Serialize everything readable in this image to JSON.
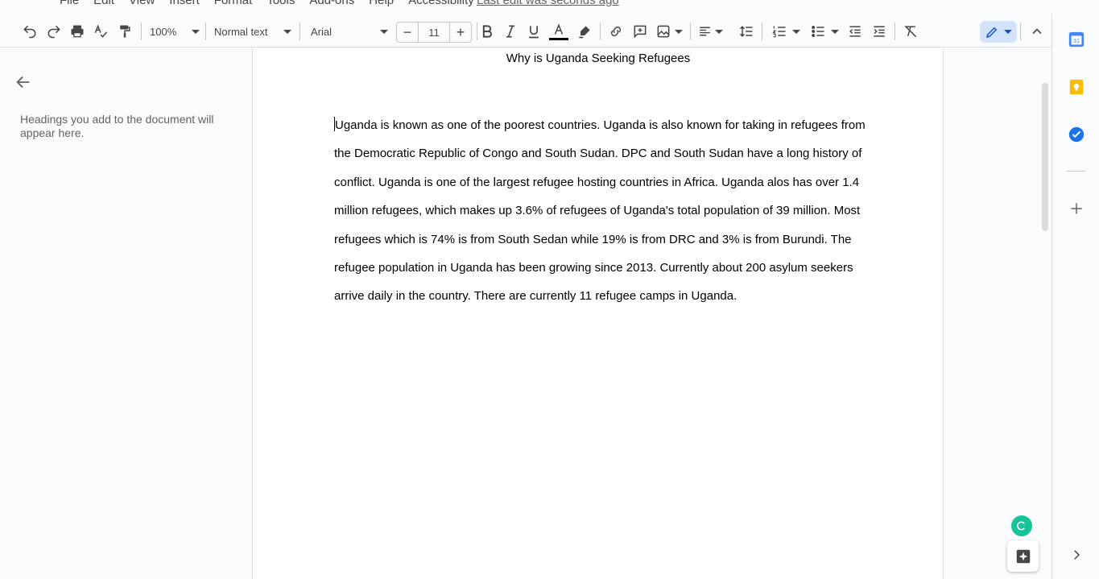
{
  "menu": {
    "items": [
      "File",
      "Edit",
      "View",
      "Insert",
      "Format",
      "Tools",
      "Add-ons",
      "Help",
      "Accessibility"
    ],
    "last_edit": "Last edit was seconds ago"
  },
  "toolbar": {
    "zoom": "100%",
    "style": "Normal text",
    "font": "Arial",
    "font_size": "11",
    "minus": "−",
    "plus": "+"
  },
  "outline": {
    "hint": "Headings you add to the document will appear here."
  },
  "document": {
    "title": "Why is Uganda Seeking Refugees",
    "body": "Uganda is known as one of the poorest countries.  Uganda is also known for taking in refugees from the Democratic Republic of Congo and South Sudan. DPC and South Sudan have a long history of conflict. Uganda is one of the largest refugee hosting countries in Africa. Uganda alos has over  1.4 million refugees, which makes up 3.6% of refugees of Uganda's total population of 39 million. Most refugees which is 74% is from South Sedan while 19% is from DRC and 3% is from Burundi.  The refugee population in Uganda has been growing since 2013. Currently about 200 asylum seekers arrive daily in the country. There are currently 11 refugee camps in Uganda."
  },
  "sidepanel": {
    "calendar_day": "31"
  },
  "colors": {
    "accent": "#0b57d0",
    "text_color_bar": "#000000",
    "keep_yellow": "#fbbc04",
    "tasks_blue": "#1a73e8",
    "grammarly_green": "#15c39a"
  }
}
